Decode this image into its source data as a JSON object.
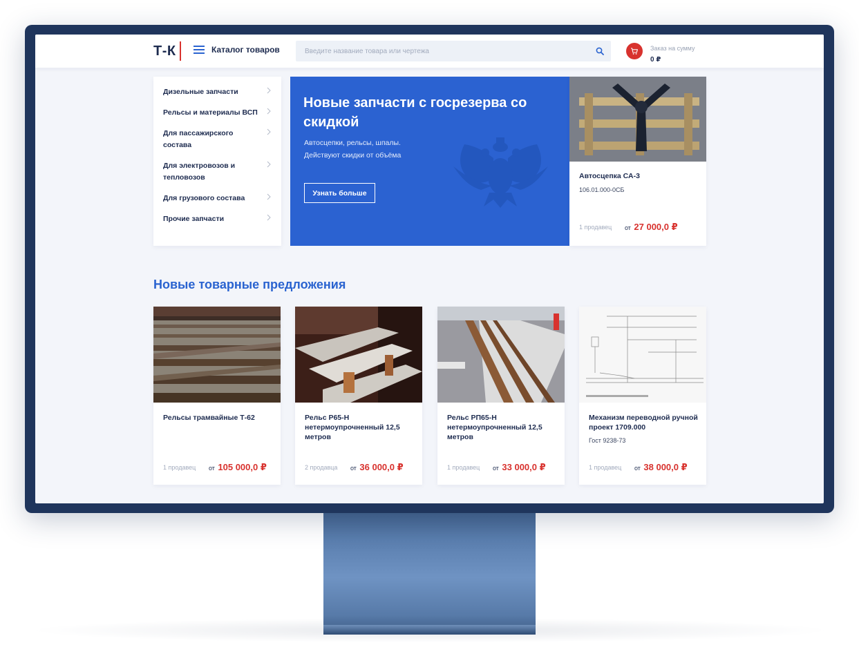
{
  "header": {
    "logo": "Т-К",
    "catalog_label": "Каталог товаров",
    "search_placeholder": "Введите название товара или чертежа",
    "order_label": "Заказ на сумму",
    "order_sum": "0 ₽"
  },
  "sidebar": {
    "items": [
      {
        "label": "Дизельные запчасти"
      },
      {
        "label": "Рельсы и материалы ВСП"
      },
      {
        "label": "Для пассажирского состава"
      },
      {
        "label": "Для электровозов и тепловозов"
      },
      {
        "label": "Для грузового состава"
      },
      {
        "label": "Прочие запчасти"
      }
    ]
  },
  "banner": {
    "title": "Новые запчасти с госрезерва со скидкой",
    "line1": "Автосцепки, рельсы, шпалы.",
    "line2": "Действуют скидки от объёма",
    "button": "Узнать больше",
    "color": "#2b62d1"
  },
  "featured": {
    "title": "Автосцепка СА-3",
    "code": "106.01.000-0СБ",
    "sellers": "1 продавец",
    "price_from": "от",
    "price": "27 000,0 ₽"
  },
  "section": {
    "title": "Новые товарные предложения"
  },
  "products": [
    {
      "title": "Рельсы трамвайные Т-62",
      "code": "",
      "sellers": "1 продавец",
      "price_from": "от",
      "price": "105 000,0 ₽"
    },
    {
      "title": "Рельс Р65-Н нетермоупрочненный 12,5 метров",
      "code": "",
      "sellers": "2 продавца",
      "price_from": "от",
      "price": "36 000,0 ₽"
    },
    {
      "title": "Рельс РП65-Н нетермоупрочненный 12,5 метров",
      "code": "",
      "sellers": "1 продавец",
      "price_from": "от",
      "price": "33 000,0 ₽"
    },
    {
      "title": "Механизм переводной ручной проект 1709.000",
      "code": "Гост 9238-73",
      "sellers": "1 продавец",
      "price_from": "от",
      "price": "38 000,0 ₽"
    }
  ],
  "colors": {
    "accent": "#2a63d0",
    "price": "#d8322e",
    "frame": "#1f355c"
  }
}
